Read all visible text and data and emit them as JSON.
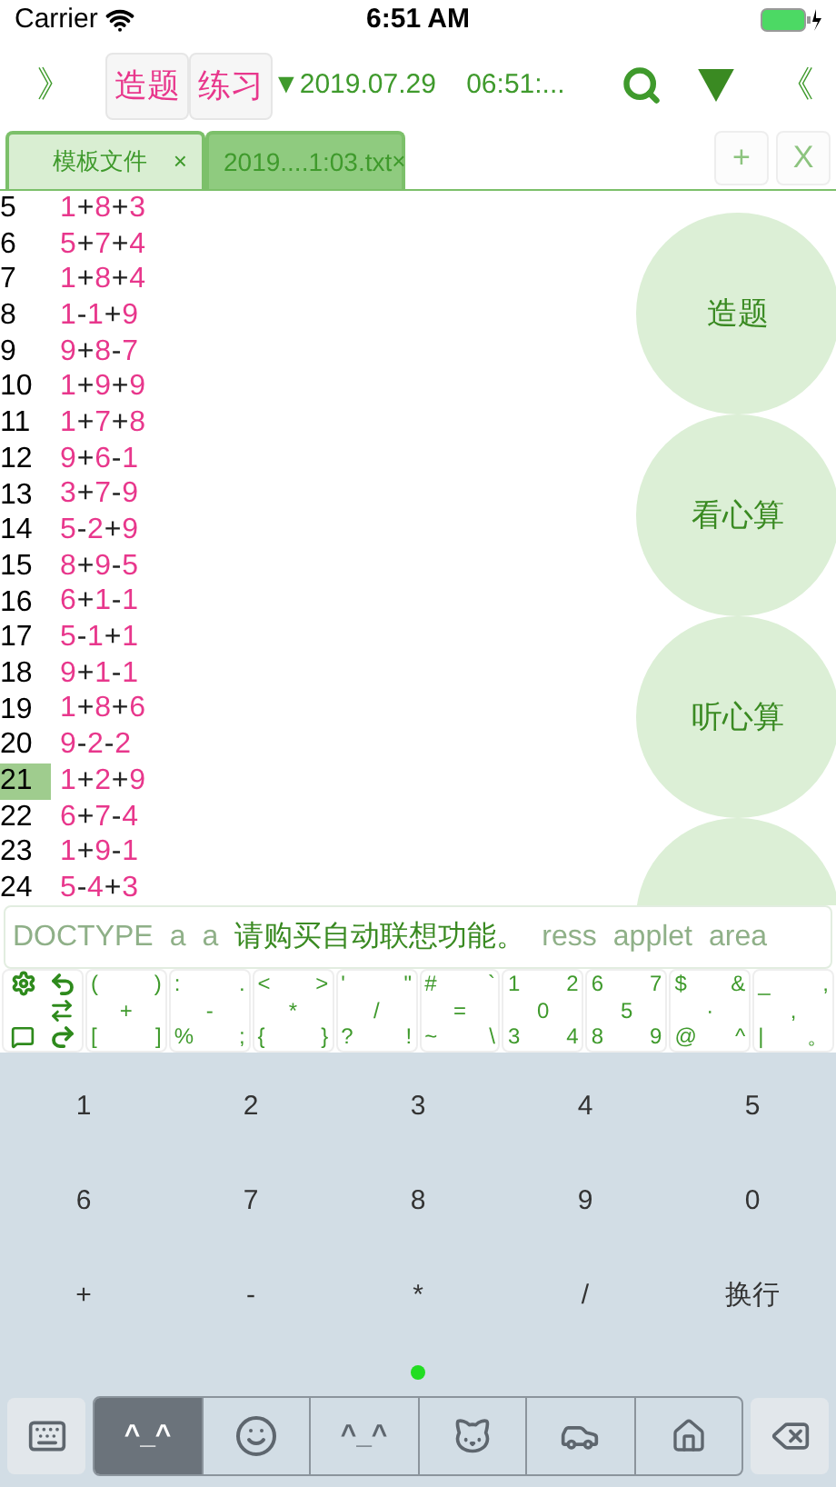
{
  "status_bar": {
    "carrier": "Carrier",
    "time": "6:51 AM"
  },
  "toolbar": {
    "left_arrow": "》",
    "buttons": [
      "造题",
      "练习"
    ],
    "date_time": "▼2019.07.29    06:51:...",
    "right_arrow": "《"
  },
  "tabs": [
    {
      "label": "模板文件",
      "close": "×",
      "selected": false
    },
    {
      "label": "2019....1:03.txt",
      "close": "×",
      "selected": true
    }
  ],
  "tab_actions": [
    "+",
    "X"
  ],
  "editor": {
    "lines": [
      {
        "number": "5",
        "text": "1+8+3",
        "selected": false
      },
      {
        "number": "6",
        "text": "5+7+4",
        "selected": false
      },
      {
        "number": "7",
        "text": "1+8+4",
        "selected": false
      },
      {
        "number": "8",
        "text": "1-1+9",
        "selected": false
      },
      {
        "number": "9",
        "text": "9+8-7",
        "selected": false
      },
      {
        "number": "10",
        "text": "1+9+9",
        "selected": false
      },
      {
        "number": "11",
        "text": "1+7+8",
        "selected": false
      },
      {
        "number": "12",
        "text": "9+6-1",
        "selected": false
      },
      {
        "number": "13",
        "text": "3+7-9",
        "selected": false
      },
      {
        "number": "14",
        "text": "5-2+9",
        "selected": false
      },
      {
        "number": "15",
        "text": "8+9-5",
        "selected": false
      },
      {
        "number": "16",
        "text": "6+1-1",
        "selected": false
      },
      {
        "number": "17",
        "text": "5-1+1",
        "selected": false
      },
      {
        "number": "18",
        "text": "9+1-1",
        "selected": false
      },
      {
        "number": "19",
        "text": "1+8+6",
        "selected": false
      },
      {
        "number": "20",
        "text": "9-2-2",
        "selected": false
      },
      {
        "number": "21",
        "text": "1+2+9",
        "selected": true
      },
      {
        "number": "22",
        "text": "6+7-4",
        "selected": false
      },
      {
        "number": "23",
        "text": "1+9-1",
        "selected": false
      },
      {
        "number": "24",
        "text": "5-4+3",
        "selected": false
      }
    ]
  },
  "side_buttons": [
    "造题",
    "看心算",
    "听心算"
  ],
  "suggestions": {
    "words_before": [
      "DOCTYPE",
      "a",
      "a"
    ],
    "message": "请购买自动联想功能。",
    "words_after": [
      "ress",
      "applet",
      "area"
    ]
  },
  "symbol_keys": [
    [
      "(",
      ")",
      "+",
      "[",
      "]"
    ],
    [
      ":",
      ".",
      "-",
      "%",
      ";"
    ],
    [
      "<",
      ">",
      "*",
      "{",
      "}"
    ],
    [
      "'",
      "\"",
      "/",
      "?",
      "!"
    ],
    [
      "#",
      "`",
      "=",
      "~",
      "\\"
    ],
    [
      "1",
      "2",
      "0",
      "3",
      "4"
    ],
    [
      "6",
      "7",
      "5",
      "8",
      "9"
    ],
    [
      "$",
      "&",
      "·",
      "@",
      "^"
    ],
    [
      "_",
      ",",
      ",",
      "|",
      "。"
    ]
  ],
  "number_pad": [
    [
      "1",
      "2",
      "3",
      "4",
      "5"
    ],
    [
      "6",
      "7",
      "8",
      "9",
      "0"
    ],
    [
      "+",
      "-",
      "*",
      "/",
      "换行"
    ]
  ],
  "bottom_bar": [
    {
      "kind": "kaomoji",
      "label": "^_^",
      "selected": true
    },
    {
      "kind": "smiley",
      "selected": false
    },
    {
      "kind": "kaomoji",
      "label": "^_^",
      "selected": false
    },
    {
      "kind": "animal",
      "selected": false
    },
    {
      "kind": "car",
      "selected": false
    },
    {
      "kind": "house",
      "selected": false
    }
  ]
}
